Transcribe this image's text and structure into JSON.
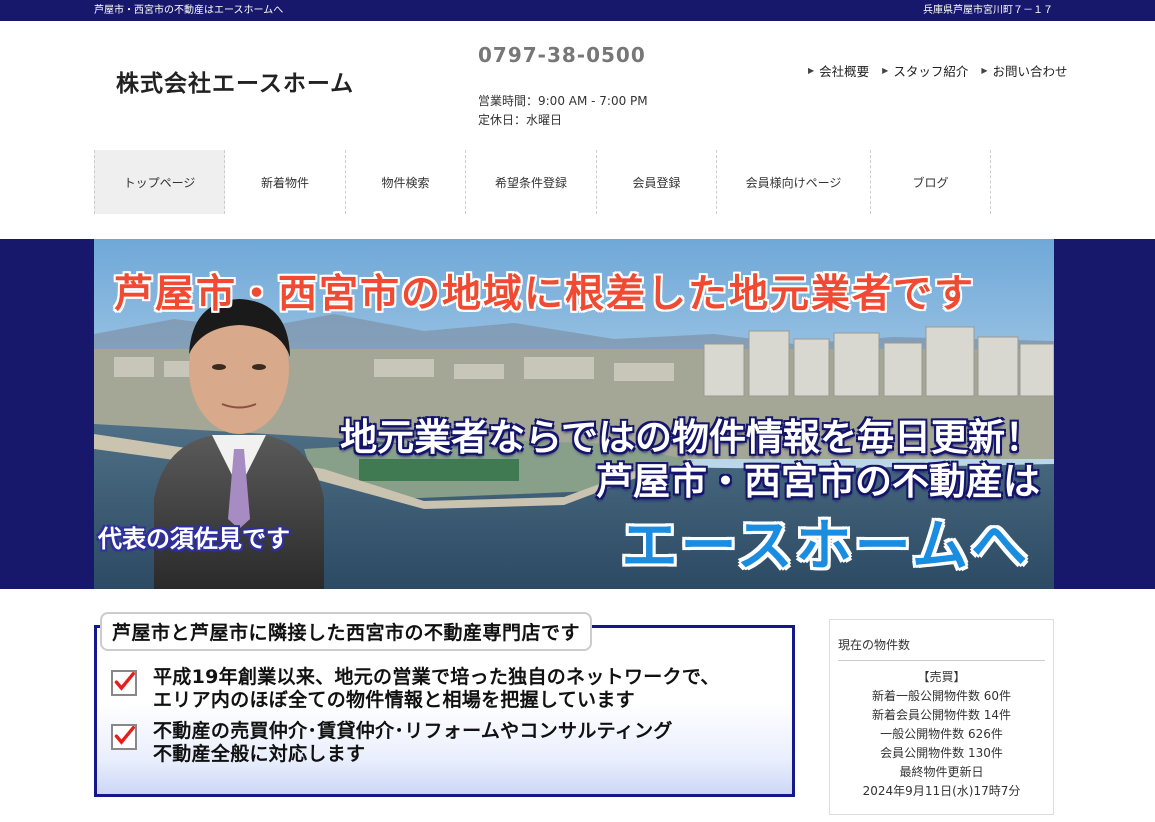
{
  "topbar": {
    "left_text": "芦屋市・西宮市の不動産はエースホームへ",
    "right_text": "兵庫県芦屋市宮川町７－１７"
  },
  "header": {
    "logo_text": "株式会社エースホーム",
    "phone": "0797-38-0500",
    "hours": "営業時間：9:00 AM - 7:00 PM",
    "holiday": "定休日：水曜日",
    "links": [
      {
        "label": "会社概要",
        "icon": "chevron-right-icon"
      },
      {
        "label": "スタッフ紹介",
        "icon": "chevron-right-icon"
      },
      {
        "label": "お問い合わせ",
        "icon": "chevron-right-icon"
      }
    ]
  },
  "nav": {
    "items": [
      {
        "label": "トップページ",
        "active": true
      },
      {
        "label": "新着物件",
        "active": false
      },
      {
        "label": "物件検索",
        "active": false
      },
      {
        "label": "希望条件登録",
        "active": false
      },
      {
        "label": "会員登録",
        "active": false
      },
      {
        "label": "会員様向けページ",
        "active": false
      },
      {
        "label": "ブログ",
        "active": false
      }
    ]
  },
  "hero": {
    "headline": "芦屋市・西宮市の地域に根差した地元業者です",
    "line2": "地元業者ならではの物件情報を毎日更新！",
    "line3": "芦屋市・西宮市の不動産は",
    "brand": "エースホームへ",
    "caption": "代表の須佐見です"
  },
  "panel": {
    "title": "芦屋市と芦屋市に隣接した西宮市の不動産専門店です",
    "points": [
      {
        "line1": "平成19年創業以来、地元の営業で培った独自のネットワークで、",
        "line2": "エリア内のほぼ全ての物件情報と相場を把握しています"
      },
      {
        "line1": "不動産の売買仲介･賃貸仲介･リフォームやコンサルティング",
        "line2": "不動産全般に対応します"
      }
    ]
  },
  "sidebar": {
    "title": "現在の物件数",
    "section": "【売買】",
    "lines": [
      "新着一般公開物件数 60件",
      "新着会員公開物件数 14件",
      "一般公開物件数 626件",
      "会員公開物件数 130件",
      "最終物件更新日",
      "2024年9月11日(水)17時7分"
    ]
  },
  "colors": {
    "topbar": "#17186b",
    "hero_headline": "#f04a33",
    "brand_blue": "#1a8de0",
    "panel_border": "#14188a",
    "check_red": "#e0201c"
  }
}
